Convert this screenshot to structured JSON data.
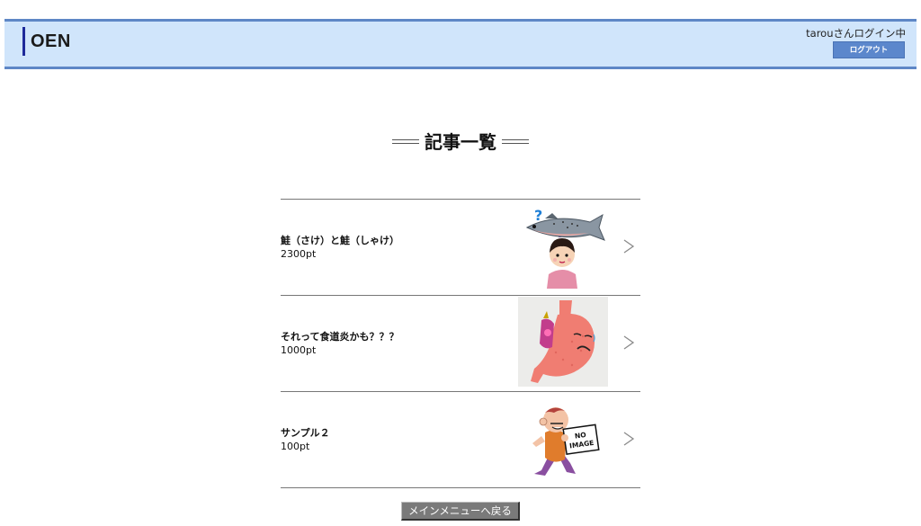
{
  "header": {
    "logo": "OEN",
    "login_status": "tarouさんログイン中",
    "logout_label": "ログアウト"
  },
  "page": {
    "title": "記事一覧"
  },
  "articles": [
    {
      "title": "鮭（さけ）と鮭（しゃけ）",
      "points": "2300pt",
      "thumb_icon": "salmon-question-illustration"
    },
    {
      "title": "それって食道炎かも？？？",
      "points": "1000pt",
      "thumb_icon": "stomach-illustration"
    },
    {
      "title": "サンプル２",
      "points": "100pt",
      "thumb_icon": "no-image-illustration",
      "thumb_text_1": "NO",
      "thumb_text_2": "IMAGE"
    }
  ],
  "footer": {
    "back_label": "メインメニューへ戻る"
  },
  "colors": {
    "header_bg": "#d0e5fb",
    "header_border": "#5e87c6",
    "logout_bg": "#5b87cc",
    "back_bg": "#7a7a7a"
  }
}
